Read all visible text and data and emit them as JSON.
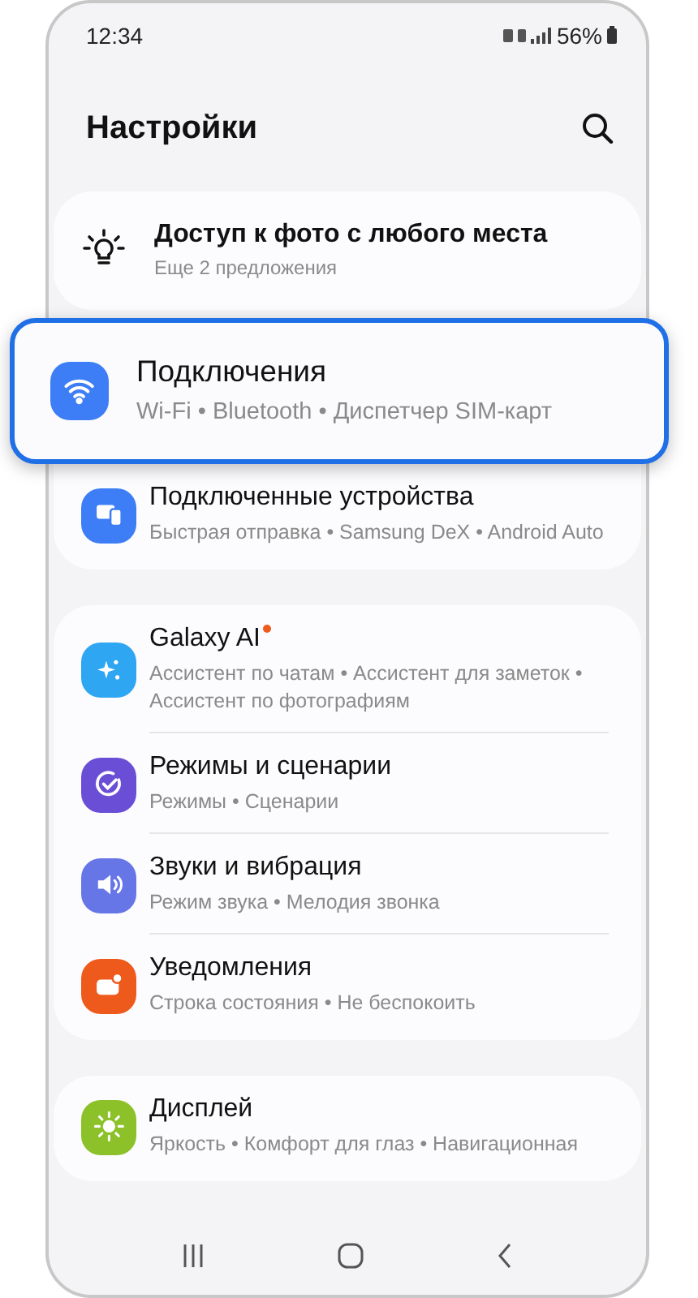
{
  "status_bar": {
    "time": "12:34",
    "battery": "56%"
  },
  "header": {
    "title": "Настройки"
  },
  "suggestion": {
    "title": "Доступ к фото с любого места",
    "subtitle": "Еще 2 предложения"
  },
  "groups": [
    {
      "items": [
        {
          "kind": "wifi",
          "color": "#3d7df6",
          "title": "Подключения",
          "subtitle": "Wi-Fi • Bluetooth • Диспетчер SIM-карт",
          "highlighted": true,
          "new_dot": false
        },
        {
          "kind": "devices",
          "color": "#3d7df6",
          "title": "Подключенные устройства",
          "subtitle": "Быстрая отправка • Samsung DeX • Android Auto",
          "highlighted": false,
          "new_dot": false
        }
      ]
    },
    {
      "items": [
        {
          "kind": "sparkle",
          "color": "#2fa6f2",
          "title": "Galaxy AI",
          "subtitle": "Ассистент по чатам • Ассистент для заметок • Ассистент по фотографиям",
          "highlighted": false,
          "new_dot": true
        },
        {
          "kind": "modes",
          "color": "#6a4fd6",
          "title": "Режимы и сценарии",
          "subtitle": "Режимы • Сценарии",
          "highlighted": false,
          "new_dot": false
        },
        {
          "kind": "sound",
          "color": "#6676e6",
          "title": "Звуки и вибрация",
          "subtitle": "Режим звука • Мелодия звонка",
          "highlighted": false,
          "new_dot": false
        },
        {
          "kind": "notify",
          "color": "#ee5a1c",
          "title": "Уведомления",
          "subtitle": "Строка состояния • Не беспокоить",
          "highlighted": false,
          "new_dot": false
        }
      ]
    },
    {
      "items": [
        {
          "kind": "sun",
          "color": "#8cc12a",
          "title": "Дисплей",
          "subtitle": "Яркость • Комфорт для глаз • Навигационная",
          "highlighted": false,
          "new_dot": false
        }
      ]
    }
  ]
}
